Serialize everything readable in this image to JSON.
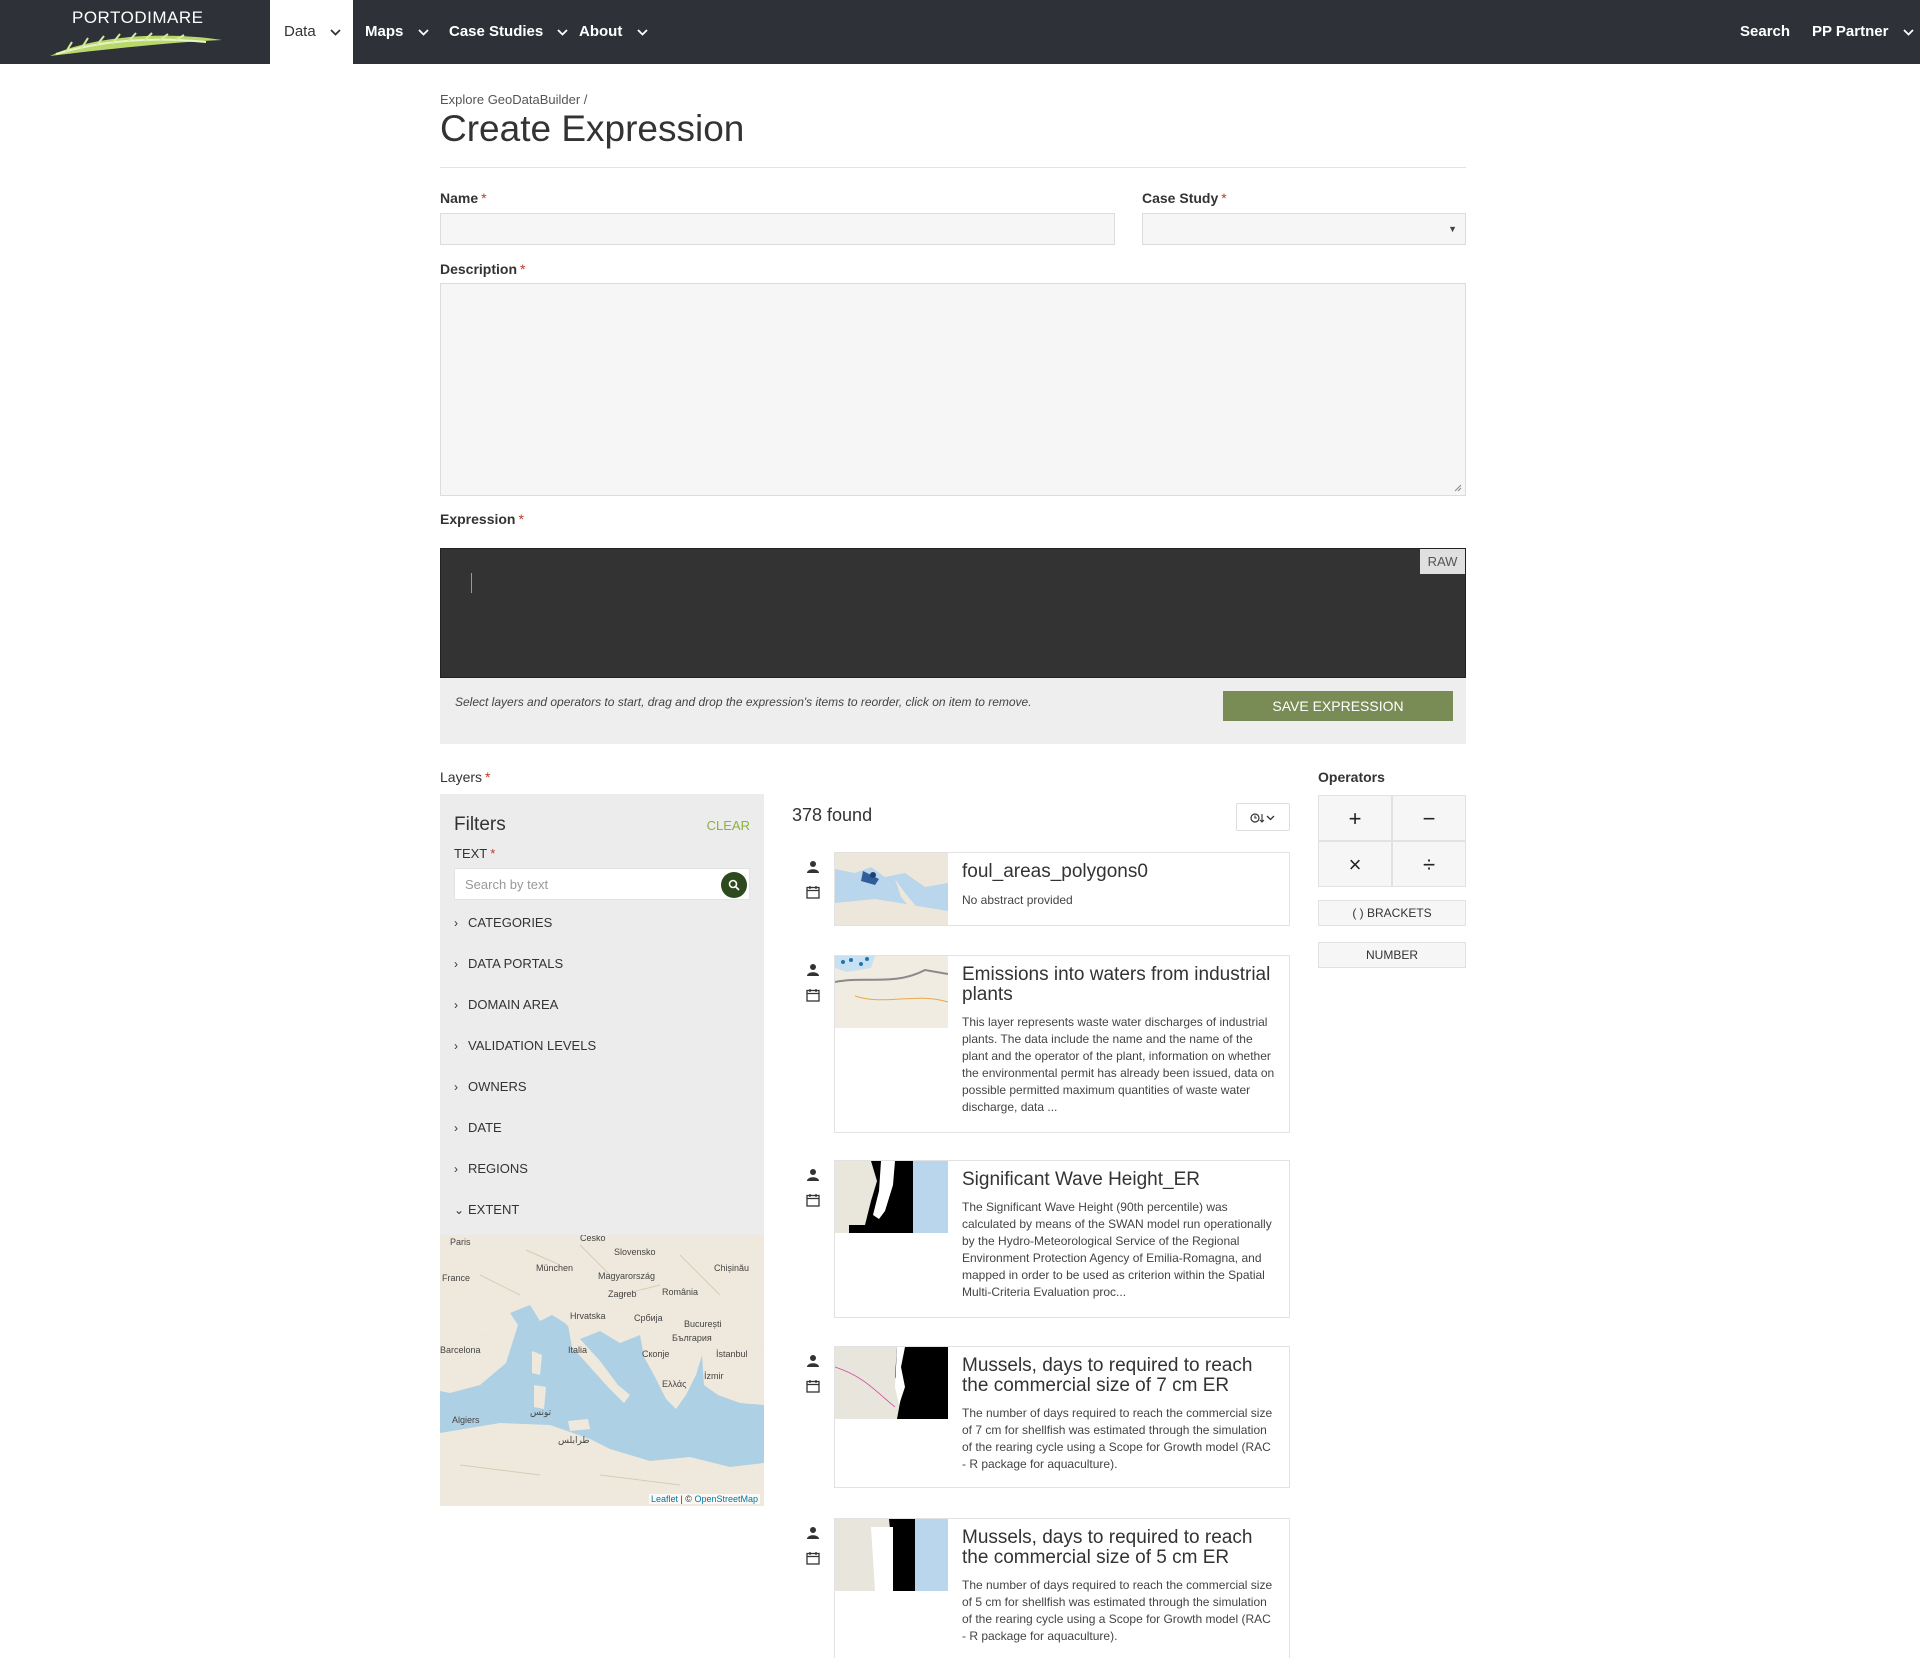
{
  "nav": {
    "logo": "PORTODIMARE",
    "items": [
      "Data",
      "Maps",
      "Case Studies",
      "About"
    ],
    "search": "Search",
    "partner": "PP Partner"
  },
  "page": {
    "breadcrumb": "Explore GeoDataBuilder /",
    "title": "Create Expression"
  },
  "form": {
    "name_label": "Name",
    "case_study_label": "Case Study",
    "description_label": "Description",
    "expression_label": "Expression",
    "required_mark": "*",
    "raw_label": "RAW",
    "hint": "Select layers and operators to start, drag and drop the expression's items to reorder, click on item to remove.",
    "save_label": "SAVE EXPRESSION",
    "layers_label": "Layers"
  },
  "filters": {
    "title": "Filters",
    "clear": "CLEAR",
    "text_label": "TEXT",
    "search_placeholder": "Search by text",
    "facets": [
      "CATEGORIES",
      "DATA PORTALS",
      "DOMAIN AREA",
      "VALIDATION LEVELS",
      "OWNERS",
      "DATE",
      "REGIONS",
      "EXTENT"
    ],
    "map_labels": [
      "Paris",
      "Česko",
      "Slovensko",
      "France",
      "München",
      "Magyarország",
      "Chișinău",
      "Zagreb",
      "România",
      "Hrvatska",
      "Србија",
      "București",
      "България",
      "Barcelona",
      "Italia",
      "Скопје",
      "İstanbul",
      "Ελλάς",
      "İzmir",
      "Algiers",
      "تونس",
      "طرابلس"
    ],
    "attribution_leaflet": "Leaflet",
    "attribution_sep": " | © ",
    "attribution_osm": "OpenStreetMap"
  },
  "results": {
    "found": "378 found",
    "items": [
      {
        "title": "foul_areas_polygons0",
        "desc": "No abstract provided"
      },
      {
        "title": "Emissions into waters from industrial plants",
        "desc": "This layer represents waste water discharges of industrial plants. The data include the name and the name of the plant and the operator of the plant, information on whether the environmental permit has already been issued, data on possible permitted maximum quantities of waste water discharge, data ..."
      },
      {
        "title": "Significant Wave Height_ER",
        "desc": "The Significant Wave Height (90th percentile) was calculated by means of the SWAN model run operationally by the Hydro-Meteorological Service of the Regional Environment Protection Agency of Emilia-Romagna, and mapped in order to be used as criterion within the Spatial Multi-Criteria Evaluation proc..."
      },
      {
        "title": "Mussels, days to required to reach the commercial size of 7 cm ER",
        "desc": "The number of days required to reach the commercial size of 7 cm for shellfish was estimated through the simulation of the rearing cycle using a Scope for Growth model (RAC - R package for aquaculture)."
      },
      {
        "title": "Mussels, days to required to reach the commercial size of 5 cm ER",
        "desc": "The number of days required to reach the commercial size of 5 cm for shellfish was estimated through the simulation of the rearing cycle using a Scope for Growth model (RAC - R package for aquaculture)."
      }
    ]
  },
  "operators": {
    "label": "Operators",
    "symbols": [
      "+",
      "−",
      "×",
      "÷"
    ],
    "brackets": "( ) BRACKETS",
    "number": "NUMBER"
  },
  "colors": {
    "nav_bg": "#2e3238",
    "save_button": "#7a8c55",
    "editor_bg": "#333333",
    "clear_link": "#8db13c",
    "search_go": "#2d4a1e"
  }
}
